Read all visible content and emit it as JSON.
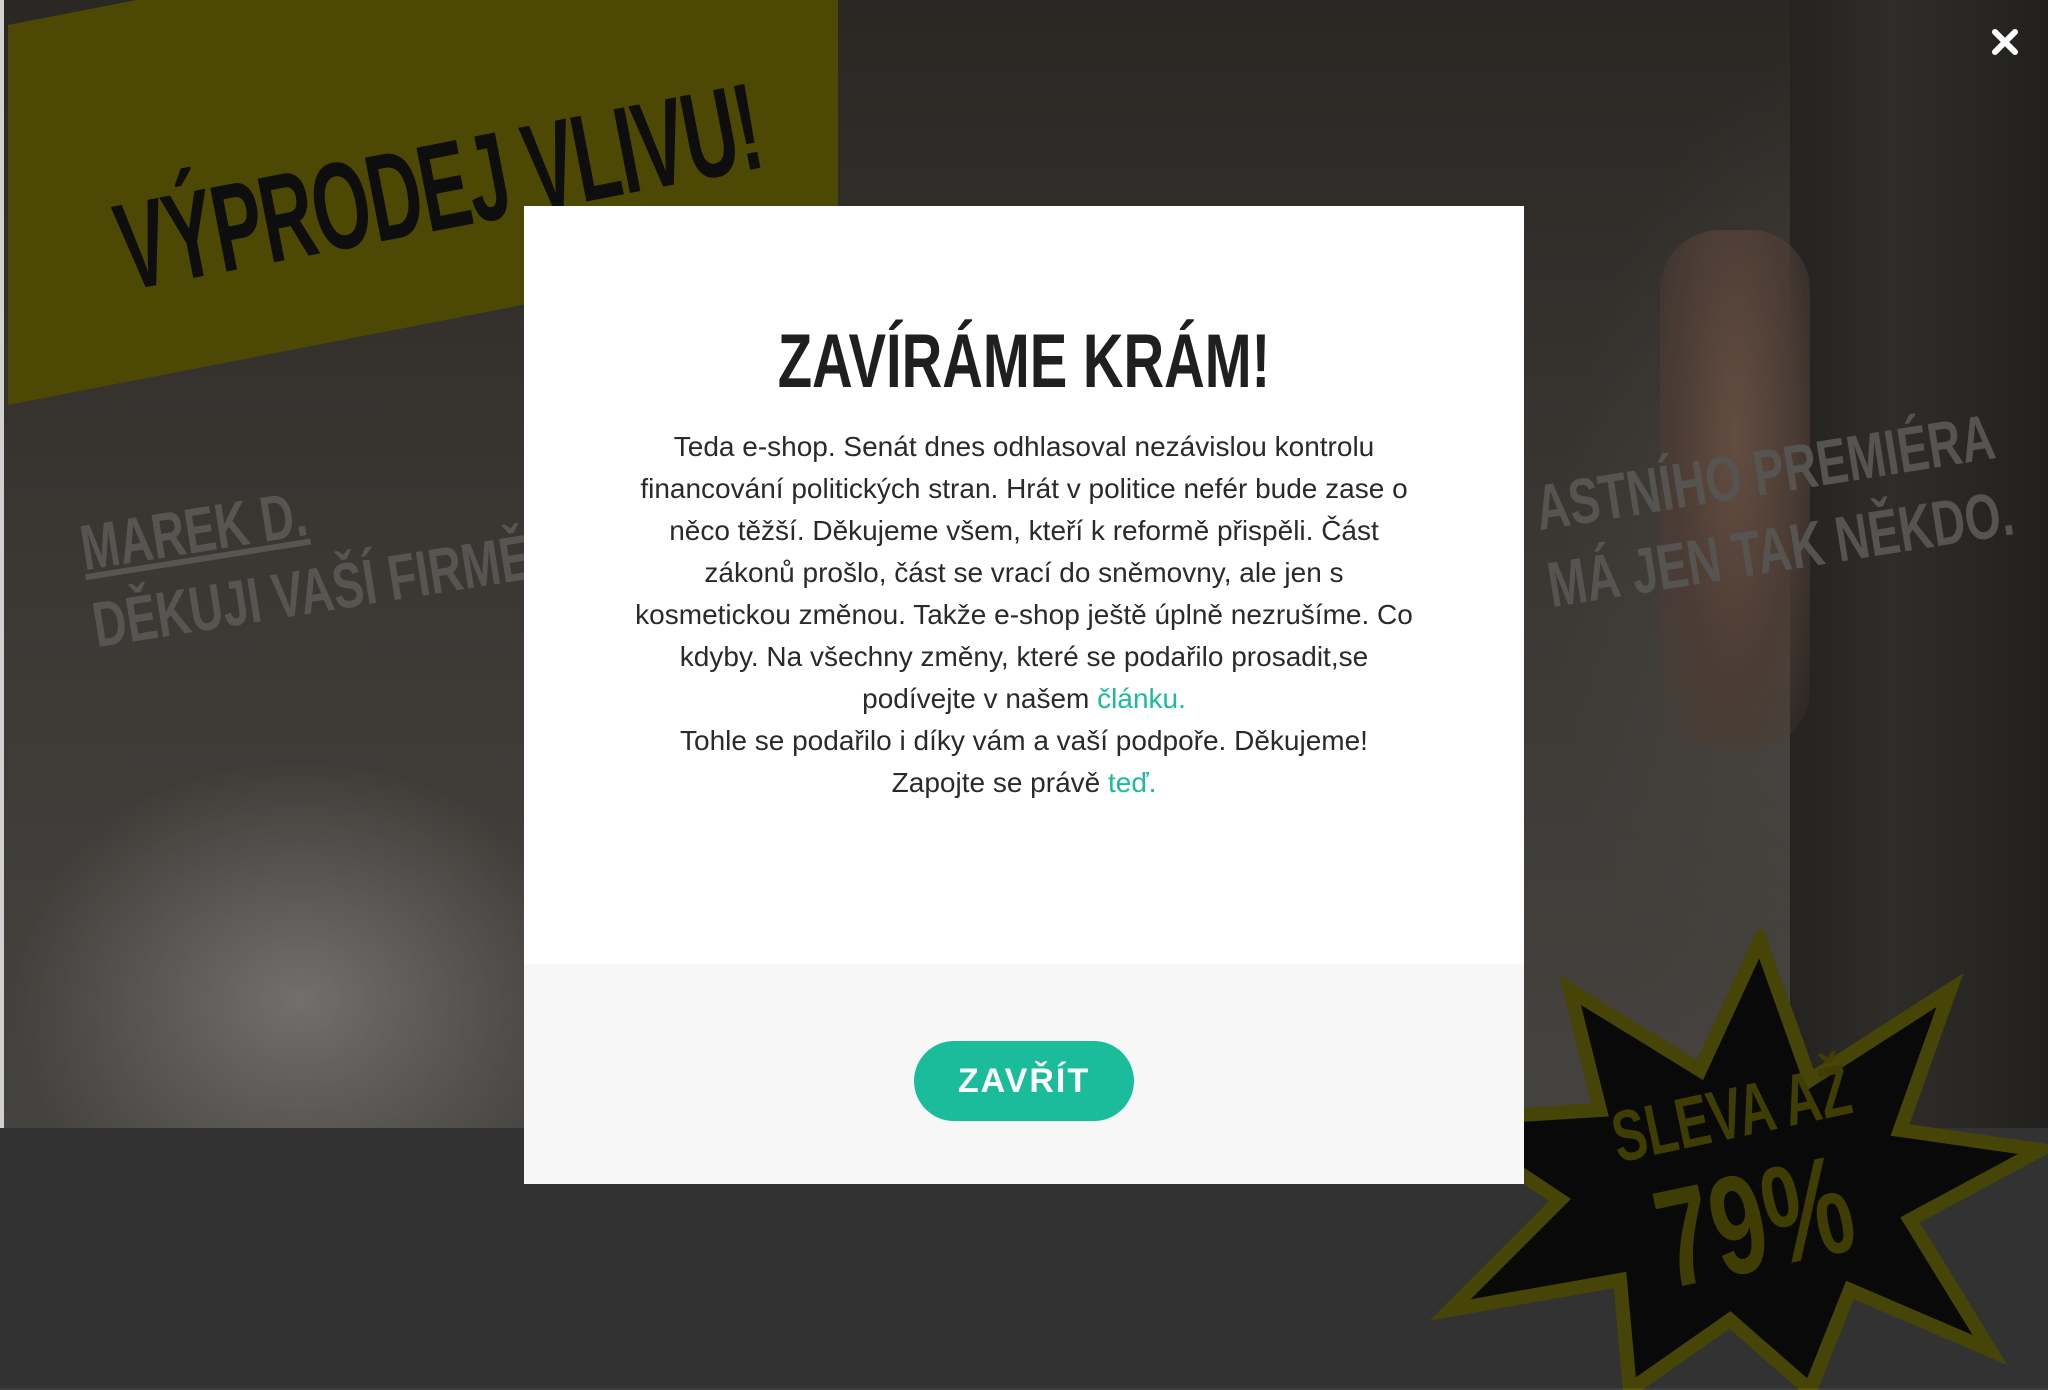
{
  "background": {
    "banner_text": "VÝPRODEJ VLIVU!",
    "left_quote": {
      "name": "MAREK D.",
      "line": "DĚKUJI VAŠÍ FIRMĚ."
    },
    "right_quote": {
      "line1": "ASTNÍHO PREMIÉRA",
      "line2": "MÁ JEN TAK NĚKDO."
    },
    "badge": {
      "line1": "SLEVA AŽ",
      "line2": "79%"
    },
    "colors": {
      "banner": "#5e5a05",
      "badge_star": "#0b0b0b",
      "badge_outline": "#57530a"
    }
  },
  "close_icon": "close-icon",
  "modal": {
    "title": "ZAVÍRÁME KRÁM!",
    "paragraph_intro": "Teda e-shop. Senát dnes odhlasoval nezávislou kontrolu financování politických stran. Hrát v politice nefér bude zase o něco těžší. Děkujeme všem, kteří k reformě přispěli. Část zákonů prošlo, část se vrací do sněmovny, ale jen s kosmetickou změnou. Takže e-shop ještě úplně nezrušíme. Co kdyby. Na všechny změny, které se podařilo prosadit,se podívejte v našem",
    "article_link": "článku.",
    "thanks_line": "Tohle se podařilo i díky vám a vaší podpoře. Děkujeme!",
    "join_text": "Zapojte se právě",
    "join_link": "teď.",
    "close_button": "ZAVŘÍT",
    "accent_color": "#1abc9c"
  }
}
